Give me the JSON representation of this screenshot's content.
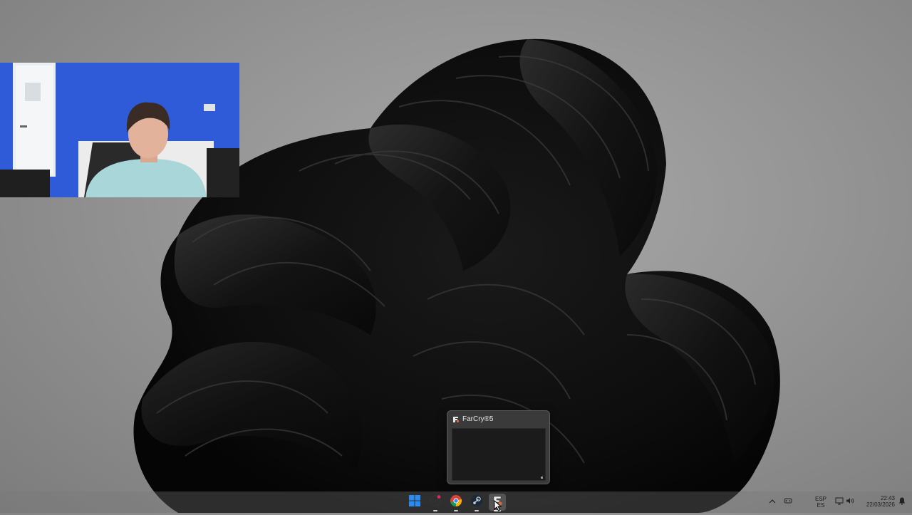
{
  "desktop": {
    "wallpaper": "windows-11-dark-bloom"
  },
  "webcam": {
    "description": "webcam-overlay"
  },
  "taskbar": {
    "apps": [
      {
        "name": "start-button",
        "icon": "windows-logo-icon"
      },
      {
        "name": "app-icon-1",
        "icon": "vector-app-icon"
      },
      {
        "name": "app-icon-chrome",
        "icon": "chrome-icon"
      },
      {
        "name": "app-icon-steam",
        "icon": "steam-icon"
      },
      {
        "name": "app-icon-farcry",
        "icon": "farcry-icon"
      }
    ],
    "tray": {
      "lang_top": "ESP",
      "lang_bottom": "ES",
      "time": "22:43",
      "date": "22/03/2026"
    }
  },
  "thumbnail": {
    "title": "FarCry®5"
  },
  "colors": {
    "windows_blue": "#1e90ff",
    "notification_dot": "#e0245e"
  }
}
